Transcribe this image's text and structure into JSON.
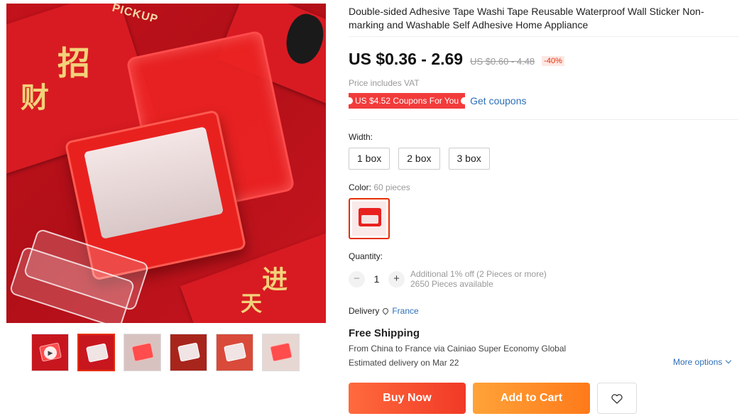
{
  "product": {
    "title": "Double-sided Adhesive Tape Washi Tape Reusable Waterproof Wall Sticker Non-marking and Washable Self Adhesive Home Appliance",
    "price": "US $0.36 - 2.69",
    "original_price": "US $0.60 - 4.48",
    "discount": "-40%",
    "vat_note": "Price includes VAT"
  },
  "coupon": {
    "badge": "US $4.52 Coupons For You",
    "link": "Get coupons"
  },
  "gallery": {
    "brand_text": "PICKUP",
    "thumbnails": [
      {
        "kind": "video",
        "icon": "play-icon"
      },
      {
        "kind": "image",
        "active": true
      },
      {
        "kind": "image"
      },
      {
        "kind": "image"
      },
      {
        "kind": "image"
      },
      {
        "kind": "image"
      }
    ]
  },
  "width": {
    "label": "Width:",
    "options": [
      "1 box",
      "2 box",
      "3 box"
    ]
  },
  "color": {
    "label": "Color:",
    "selected": "60 pieces"
  },
  "quantity": {
    "label": "Quantity:",
    "value": "1",
    "minus": "−",
    "plus": "+",
    "note": "Additional 1% off (2 Pieces or more)",
    "available": "2650 Pieces available"
  },
  "delivery": {
    "label": "Delivery",
    "location": "France",
    "shipping_title": "Free Shipping",
    "route_prefix": "From ",
    "origin": "China",
    "route_mid": " to ",
    "destination": "France",
    "route_suffix": " via Cainiao Super Economy Global",
    "estimate_prefix": "Estimated delivery on ",
    "estimate_date": "Mar 22",
    "more_options": "More options"
  },
  "actions": {
    "buy_now": "Buy Now",
    "add_to_cart": "Add to Cart",
    "wishlist_icon": "heart-icon"
  },
  "colors": {
    "accent_red": "#e62e04",
    "link_blue": "#2e6fb7",
    "buy_gradient": [
      "#ff6a3d",
      "#f13a26"
    ],
    "cart_gradient": [
      "#ffa338",
      "#ff7a1a"
    ]
  }
}
